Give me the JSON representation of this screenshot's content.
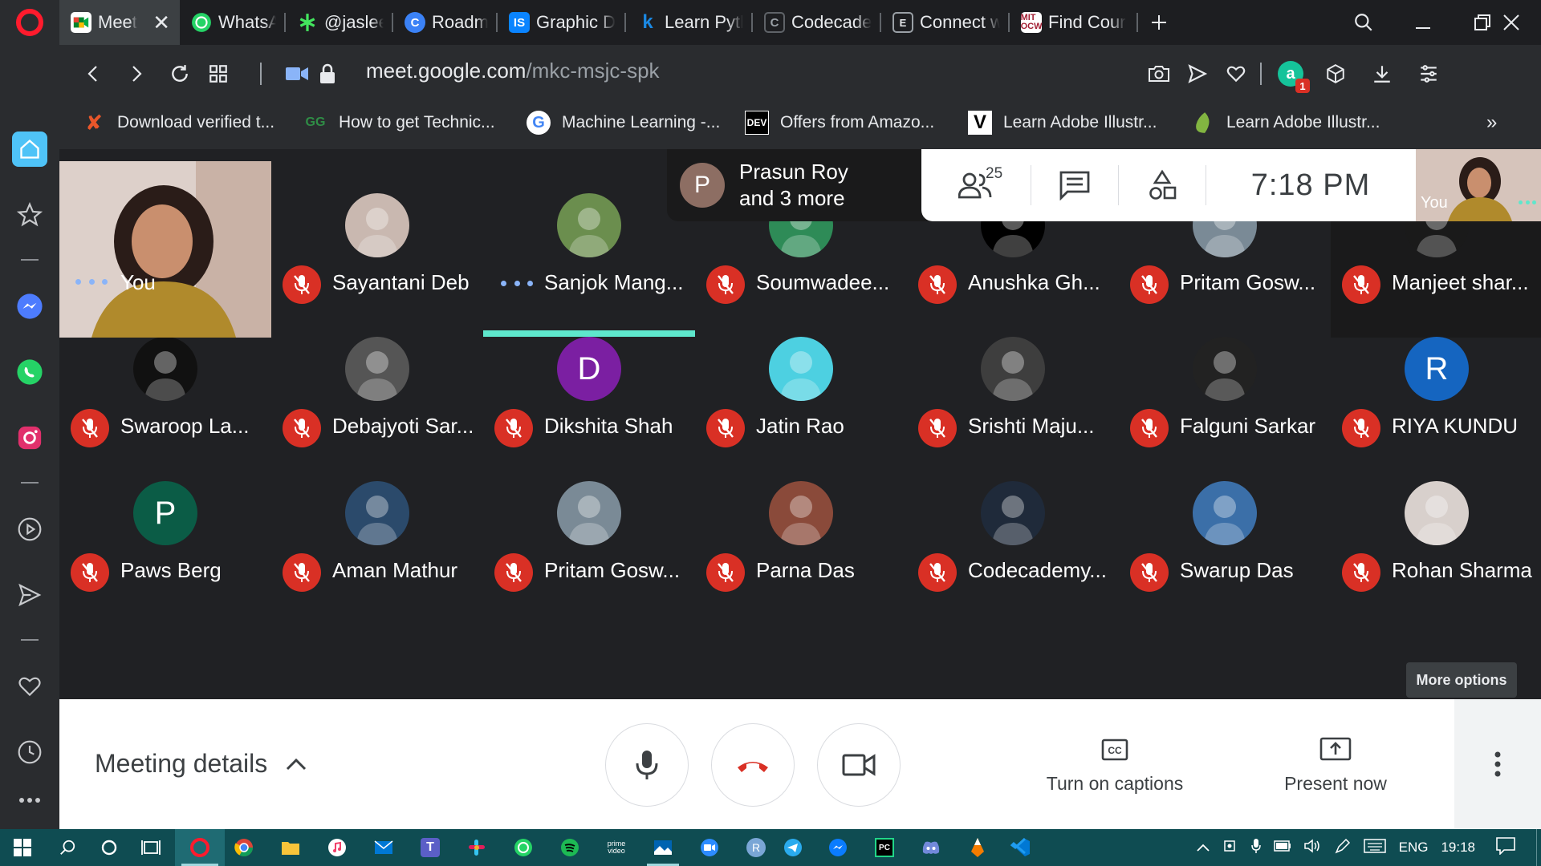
{
  "sidebar": {
    "items": [
      "home-icon",
      "star-icon",
      "messenger-icon",
      "whatsapp-icon",
      "instagram-icon",
      "player-icon",
      "send-icon",
      "heart-icon",
      "history-icon",
      "more-icon"
    ]
  },
  "tabs": [
    {
      "label": "Meet",
      "icon": "meet-icon",
      "color": "#34a853",
      "active": true
    },
    {
      "label": "WhatsApp",
      "icon": "whatsapp-icon",
      "color": "#25d366"
    },
    {
      "label": "@jasleen.c",
      "icon": "linktree-icon",
      "color": "#43e55e"
    },
    {
      "label": "Roadmap",
      "icon": "roadmap-icon",
      "color": "#3b82f6"
    },
    {
      "label": "Graphic D",
      "icon": "is-icon",
      "color": "#0a84ff"
    },
    {
      "label": "Learn Pyth",
      "icon": "k-icon",
      "color": "#1b88e2"
    },
    {
      "label": "Codecade",
      "icon": "codecademy-icon",
      "color": "#ffffff"
    },
    {
      "label": "Connect w",
      "icon": "connect-icon",
      "color": "#ffffff"
    },
    {
      "label": "Find Cour",
      "icon": "mitocw-icon",
      "color": "#a31f34"
    }
  ],
  "address": {
    "domain": "meet.google.com",
    "path": "/mkc-msjc-spk",
    "extension_badge": "1"
  },
  "bookmarks": [
    {
      "label": "Download verified t...",
      "icon": "x-icon",
      "color": "#e8562a"
    },
    {
      "label": "How to get Technic...",
      "icon": "gfg-icon",
      "color": "#2f8d46"
    },
    {
      "label": "Machine Learning -...",
      "icon": "google-icon",
      "color": "#4285f4"
    },
    {
      "label": "Offers from Amazo...",
      "icon": "dev-icon",
      "color": "#000000"
    },
    {
      "label": "Learn Adobe Illustr...",
      "icon": "v-icon",
      "color": "#000000"
    },
    {
      "label": "Learn Adobe Illustr...",
      "icon": "envato-icon",
      "color": "#82b541"
    }
  ],
  "meet": {
    "speaker_initial": "P",
    "speaker_line1": "Prasun Roy",
    "speaker_line2": "and 3 more",
    "participant_count": "25",
    "clock": "7:18 PM",
    "self_label": "You",
    "tooltip": "More options",
    "participants": [
      {
        "name": "You",
        "type": "self"
      },
      {
        "name": "Sayantani Deb",
        "muted": true,
        "avatar_color": "#c9b8b0"
      },
      {
        "name": "Sanjok Mang...",
        "muted": false,
        "avatar_color": "#6b8e4e"
      },
      {
        "name": "Soumwadee...",
        "muted": true,
        "avatar_color": "#2e8b57"
      },
      {
        "name": "Anushka Gh...",
        "muted": true,
        "avatar_color": "#000000"
      },
      {
        "name": "Pritam Gosw...",
        "muted": true,
        "avatar_color": "#7a8a96"
      },
      {
        "name": "Manjeet shar...",
        "muted": true,
        "avatar_color": "#1a1a1a"
      },
      {
        "name": "Swaroop La...",
        "muted": true,
        "avatar_color": "#111111"
      },
      {
        "name": "Debajyoti Sar...",
        "muted": true,
        "avatar_color": "#555555"
      },
      {
        "name": "Dikshita Shah",
        "muted": true,
        "avatar_color": "#7b1fa2",
        "initial": "D"
      },
      {
        "name": "Jatin Rao",
        "muted": true,
        "avatar_color": "#4dd0e1"
      },
      {
        "name": "Srishti Maju...",
        "muted": true,
        "avatar_color": "#3e3e3e"
      },
      {
        "name": "Falguni Sarkar",
        "muted": true,
        "avatar_color": "#222222"
      },
      {
        "name": "RIYA KUNDU",
        "muted": true,
        "avatar_color": "#1565c0",
        "initial": "R"
      },
      {
        "name": "Paws Berg",
        "muted": true,
        "avatar_color": "#0b5c46",
        "initial": "P"
      },
      {
        "name": "Aman Mathur",
        "muted": true,
        "avatar_color": "#2b4a6b"
      },
      {
        "name": "Pritam Gosw...",
        "muted": true,
        "avatar_color": "#7a8a96"
      },
      {
        "name": "Parna Das",
        "muted": true,
        "avatar_color": "#8a4a3a"
      },
      {
        "name": "Codecademy...",
        "muted": true,
        "avatar_color": "#1f2a3a"
      },
      {
        "name": "Swarup Das",
        "muted": true,
        "avatar_color": "#3b6fa8"
      },
      {
        "name": "Rohan Sharma",
        "muted": true,
        "avatar_color": "#d8d0cc"
      }
    ]
  },
  "controls": {
    "meeting_details": "Meeting details",
    "captions": "Turn on captions",
    "present": "Present now"
  },
  "taskbar": {
    "language": "ENG",
    "time": "19:18"
  },
  "colors": {
    "mute_red": "#d93025",
    "speaking_teal": "#5ee7cc",
    "hangup_red": "#d93025",
    "taskbar": "#0f4c52"
  }
}
